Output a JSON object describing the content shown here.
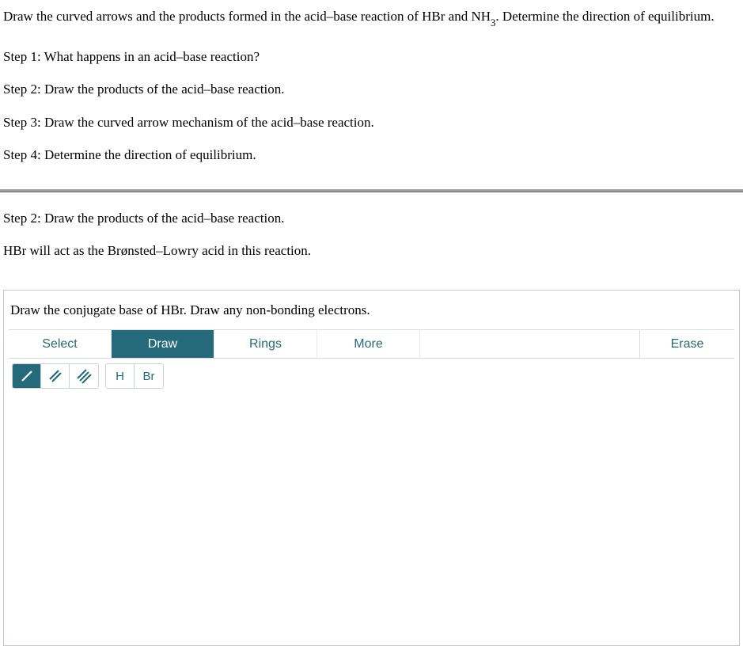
{
  "question": {
    "intro_a": "Draw the curved arrows and the products formed in the acid–base reaction of HBr and NH",
    "nh3_sub": "3",
    "intro_b": ". Determine the direction of equilibrium.",
    "steps": [
      "Step 1: What happens in an acid–base reaction?",
      "Step 2: Draw the products of the acid–base reaction.",
      "Step 3: Draw the curved arrow mechanism of the acid–base reaction.",
      "Step 4: Determine the direction of equilibrium."
    ]
  },
  "section_b": {
    "heading": "Step 2: Draw the products of the acid–base reaction.",
    "hint": "HBr will act as the Brønsted–Lowry acid in this reaction."
  },
  "editor": {
    "instruction": "Draw the conjugate base of HBr. Draw any non-bonding electrons.",
    "tabs": {
      "select": "Select",
      "draw": "Draw",
      "rings": "Rings",
      "more": "More",
      "erase": "Erase"
    },
    "elements": {
      "h": "H",
      "br": "Br"
    }
  }
}
